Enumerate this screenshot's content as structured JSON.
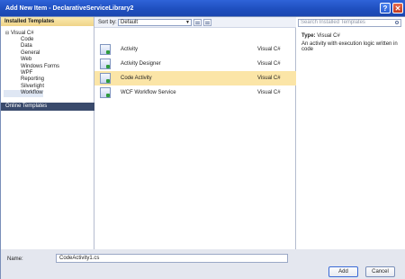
{
  "window": {
    "title": "Add New Item - DeclarativeServiceLibrary2"
  },
  "left_panel": {
    "header": "Installed Templates",
    "root": {
      "label": "Visual C#",
      "toggle": "⊟"
    },
    "children": [
      "Code",
      "Data",
      "General",
      "Web",
      "Windows Forms",
      "WPF",
      "Reporting",
      "Silverlight",
      "Workflow"
    ],
    "selected": "Workflow",
    "online_templates": "Online Templates"
  },
  "toolbar": {
    "sort_label": "Sort by:",
    "sort_value": "Default"
  },
  "items": [
    {
      "name": "Activity",
      "language": "Visual C#",
      "icon": "activity-icon"
    },
    {
      "name": "Activity Designer",
      "language": "Visual C#",
      "icon": "activity-designer-icon"
    },
    {
      "name": "Code Activity",
      "language": "Visual C#",
      "icon": "code-activity-icon",
      "selected": true
    },
    {
      "name": "WCF Workflow Service",
      "language": "Visual C#",
      "icon": "wcf-workflow-service-icon"
    }
  ],
  "details": {
    "search_placeholder": "Search Installed Templates",
    "type_label": "Type:",
    "type_value": "Visual C#",
    "description": "An activity with execution logic written in code"
  },
  "footer": {
    "name_label": "Name:",
    "name_value": "CodeActivity1.cs",
    "add_label": "Add",
    "cancel_label": "Cancel"
  },
  "colors": {
    "title_bar": "#1f4fbf",
    "selection": "#fbe5a7",
    "accent": "#3a4a6c"
  }
}
